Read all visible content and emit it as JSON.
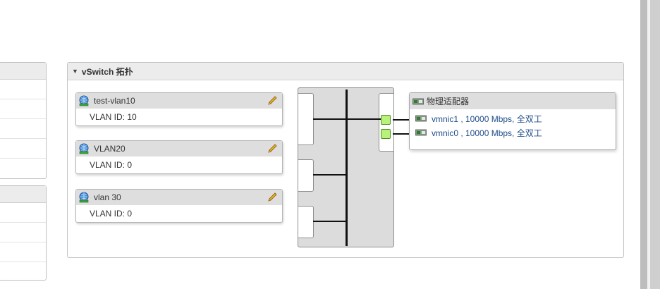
{
  "topology": {
    "title": "vSwitch 拓扑",
    "port_groups": [
      {
        "name": "test-vlan10",
        "vlan_label": "VLAN ID: 10"
      },
      {
        "name": "VLAN20",
        "vlan_label": "VLAN ID: 0"
      },
      {
        "name": "vlan 30",
        "vlan_label": "VLAN ID: 0"
      }
    ],
    "physical_adapters": {
      "title": "物理适配器",
      "items": [
        {
          "label": "vmnic1 , 10000 Mbps, 全双工"
        },
        {
          "label": "vmnic0 , 10000 Mbps, 全双工"
        }
      ]
    }
  },
  "colors": {
    "header_bg": "#ececec",
    "port_group_header_bg": "#dedede",
    "link_text": "#1e4c8a",
    "nic_port_green": "#b7f27a"
  },
  "icons": {
    "port_group": "network-globe-icon",
    "edit": "pencil-icon",
    "nic": "nic-card-icon",
    "collapse": "caret-down-icon"
  }
}
